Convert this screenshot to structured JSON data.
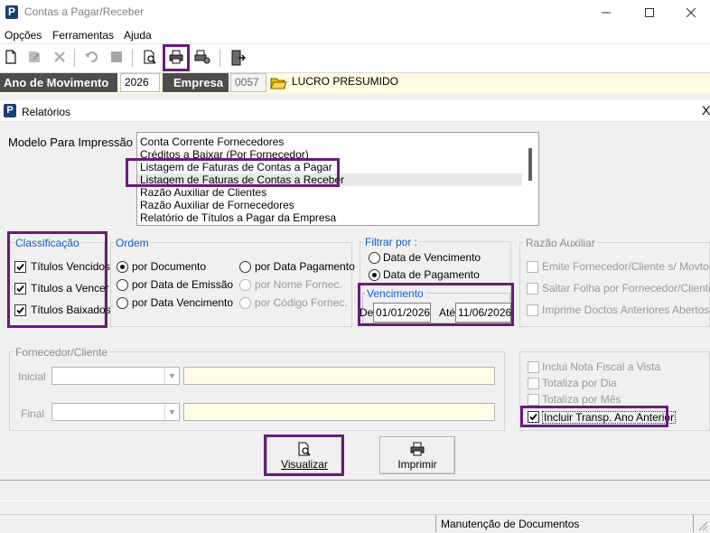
{
  "window": {
    "app_icon_letter": "P",
    "title": "Contas a Pagar/Receber"
  },
  "menu": [
    {
      "label": "Opções"
    },
    {
      "label": "Ferramentas"
    },
    {
      "label": "Ajuda"
    }
  ],
  "header": {
    "ano_label": "Ano de Movimento",
    "ano_value": "2026",
    "empresa_label": "Empresa",
    "empresa_code": "0057",
    "empresa_name": "LUCRO PRESUMIDO"
  },
  "dialog": {
    "icon_letter": "P",
    "title": "Relatórios",
    "close": "X",
    "modelo_label": "Modelo Para Impressão",
    "modelos": [
      "Conta Corrente Fornecedores",
      "Créditos a Baixar (Por Fornecedor)",
      "Listagem de Faturas de Contas a Pagar",
      "Listagem de Faturas de Contas a Receber",
      "Razão Auxiliar de Clientes",
      "Razão Auxiliar de Fornecedores",
      "Relatório de Títulos a Pagar da Empresa"
    ],
    "selected_modelo_index": 3,
    "classificacao": {
      "title": "Classificação",
      "items": [
        {
          "label": "Títulos Vencidos",
          "checked": true
        },
        {
          "label": "Títulos a Vencer",
          "checked": true
        },
        {
          "label": "Títulos Baixados",
          "checked": true
        }
      ]
    },
    "ordem": {
      "title": "Ordem",
      "options": [
        {
          "label": "por Documento",
          "selected": true,
          "enabled": true
        },
        {
          "label": "por Data de Emissão",
          "selected": false,
          "enabled": true
        },
        {
          "label": "por Data Vencimento",
          "selected": false,
          "enabled": true
        },
        {
          "label": "por Data Pagamento",
          "selected": false,
          "enabled": true
        },
        {
          "label": "por Nome Fornec.",
          "selected": false,
          "enabled": false
        },
        {
          "label": "por Código Fornec.",
          "selected": false,
          "enabled": false
        }
      ]
    },
    "filtrar": {
      "title": "Filtrar por :",
      "options": [
        {
          "label": "Data de Vencimento",
          "selected": false
        },
        {
          "label": "Data de Pagamento",
          "selected": true
        }
      ]
    },
    "vencimento": {
      "title": "Vencimento",
      "de_label": "De",
      "de_value": "01/01/2026",
      "ate_label": "Até",
      "ate_value": "11/06/2026"
    },
    "razao": {
      "title": "Razão Auxiliar",
      "items": [
        {
          "label": "Emite Fornecedor/Cliente s/ Movto",
          "checked": false
        },
        {
          "label": "Saltar Folha por Fornecedor/Cliente",
          "checked": false
        },
        {
          "label": "Imprime Doctos Anteriores Abertos",
          "checked": false
        }
      ]
    },
    "fornecedor": {
      "title": "Fornecedor/Cliente",
      "inicial_label": "Inicial",
      "final_label": "Final",
      "inicial_code": "",
      "inicial_name": "",
      "final_code": "",
      "final_name": ""
    },
    "opcoes": [
      {
        "label": "Inclui Nota Fiscal  a Vista",
        "checked": false,
        "enabled": false
      },
      {
        "label": "Totaliza por Dia",
        "checked": false,
        "enabled": false
      },
      {
        "label": "Totaliza por Mês",
        "checked": false,
        "enabled": false
      },
      {
        "label": "Incluir Transp. Ano Anterior",
        "checked": true,
        "enabled": true
      }
    ],
    "visualizar_label": "Visualizar",
    "imprimir_label": "Imprimir"
  },
  "status": {
    "panel_text": "Manutenção de Documentos"
  },
  "colors": {
    "highlight": "#6b1a7e",
    "group_title": "#0f5ec7",
    "header_label_bg": "#4d4d4d",
    "yellow_field": "#fffde6"
  }
}
